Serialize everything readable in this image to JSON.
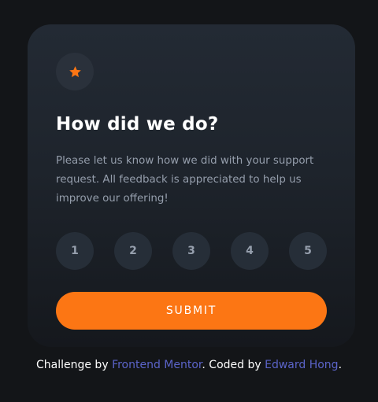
{
  "colors": {
    "background": "#131518",
    "card": "#232a34",
    "accent": "#fc7614",
    "rating_bg": "#262e38",
    "text_muted": "#959eac",
    "link": "#5b64c9"
  },
  "card": {
    "icon": "star-icon",
    "title": "How did we do?",
    "description": "Please let us know how we did with your support request. All feedback is appreciated to help us improve our offering!",
    "ratings": [
      "1",
      "2",
      "3",
      "4",
      "5"
    ],
    "submit_label": "SUBMIT"
  },
  "attribution": {
    "prefix": "Challenge by ",
    "challenge_link": "Frontend Mentor",
    "middle": ". Coded by ",
    "author_link": "Edward Hong",
    "suffix": "."
  }
}
